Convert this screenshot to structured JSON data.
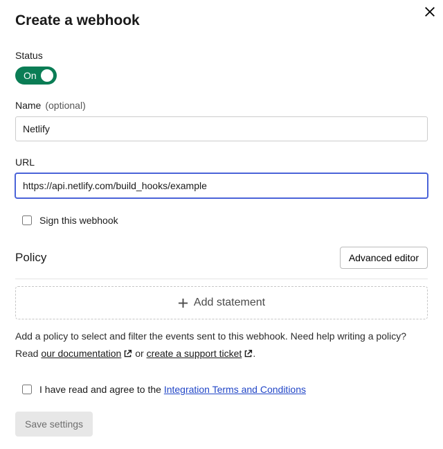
{
  "title": "Create a webhook",
  "status": {
    "label": "Status",
    "toggle_text": "On"
  },
  "name": {
    "label": "Name",
    "optional": "(optional)",
    "value": "Netlify"
  },
  "url": {
    "label": "URL",
    "value": "https://api.netlify.com/build_hooks/example"
  },
  "sign": {
    "label": "Sign this webhook"
  },
  "policy": {
    "title": "Policy",
    "advanced_button": "Advanced editor",
    "add_statement": "Add statement",
    "helper_prefix": "Add a policy to select and filter the events sent to this webhook. Need help writing a policy? Read ",
    "doc_link": "our documentation",
    "helper_or": " or ",
    "ticket_link": "create a support ticket",
    "helper_suffix": "."
  },
  "terms": {
    "prefix": "I have read and agree to the ",
    "link": "Integration Terms and Conditions"
  },
  "save_button": "Save settings"
}
